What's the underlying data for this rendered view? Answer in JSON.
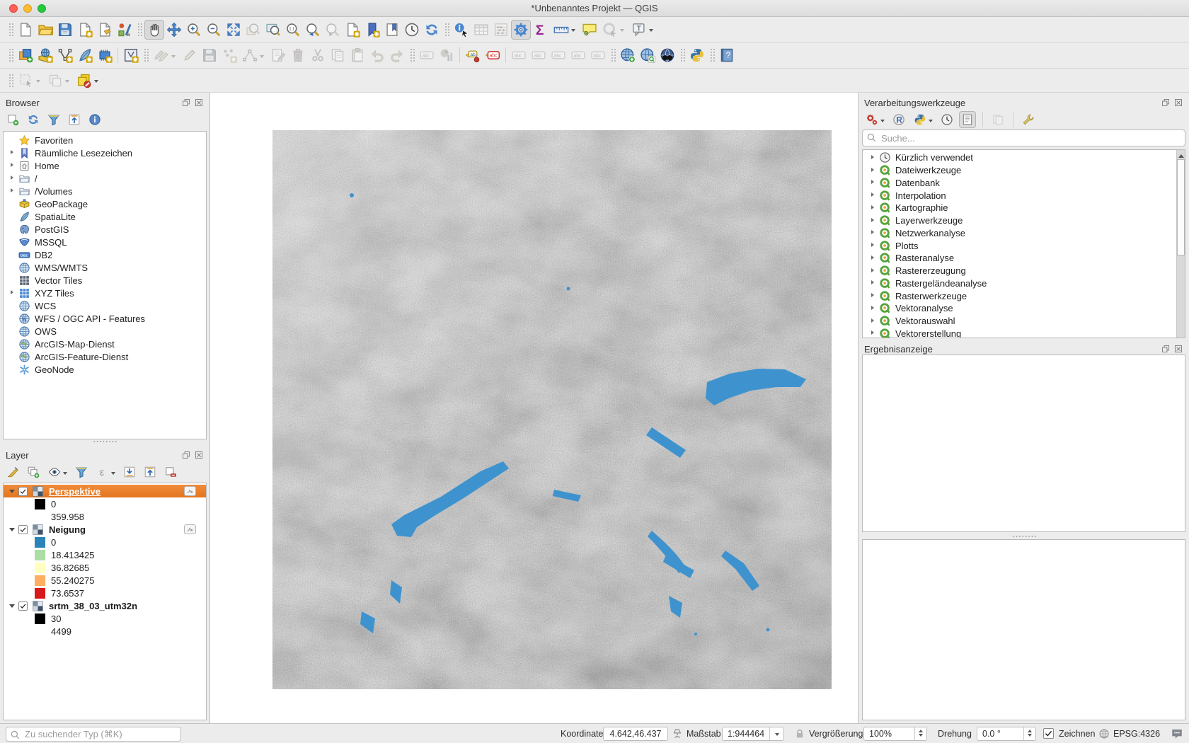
{
  "window": {
    "title": "*Unbenanntes Projekt — QGIS"
  },
  "colors": {
    "selection": "#e2761f",
    "selection_light": "#f08b3a",
    "lake": "#3e93cf"
  },
  "toolbars": {
    "row1": [
      {
        "t": "h"
      },
      {
        "t": "b",
        "name": "new-project",
        "icon": "file"
      },
      {
        "t": "b",
        "name": "open-project",
        "icon": "folder"
      },
      {
        "t": "b",
        "name": "save-project",
        "icon": "disk"
      },
      {
        "t": "b",
        "name": "new-print-layout",
        "icon": "layoutnew"
      },
      {
        "t": "b",
        "name": "layout-manager",
        "icon": "layoutmgr"
      },
      {
        "t": "b",
        "name": "style-manager",
        "icon": "style"
      },
      {
        "t": "h"
      },
      {
        "t": "b",
        "name": "pan-map",
        "icon": "hand",
        "st": "a"
      },
      {
        "t": "b",
        "name": "pan-to-selection",
        "icon": "move"
      },
      {
        "t": "b",
        "name": "zoom-in",
        "icon": "zin"
      },
      {
        "t": "b",
        "name": "zoom-out",
        "icon": "zout"
      },
      {
        "t": "b",
        "name": "zoom-full-extent",
        "icon": "zfull"
      },
      {
        "t": "b",
        "name": "zoom-to-selection",
        "icon": "zsel",
        "st": "d"
      },
      {
        "t": "b",
        "name": "zoom-to-layer",
        "icon": "zlayer"
      },
      {
        "t": "b",
        "name": "zoom-native-resolution",
        "icon": "znat"
      },
      {
        "t": "b",
        "name": "zoom-last",
        "icon": "zlast"
      },
      {
        "t": "b",
        "name": "zoom-next",
        "icon": "znext",
        "st": "d"
      },
      {
        "t": "b",
        "name": "new-map-view",
        "icon": "mapview"
      },
      {
        "t": "b",
        "name": "new-spatial-bookmark",
        "icon": "bmnew"
      },
      {
        "t": "b",
        "name": "show-spatial-bookmarks",
        "icon": "bm"
      },
      {
        "t": "b",
        "name": "temporal-controller",
        "icon": "clock"
      },
      {
        "t": "b",
        "name": "refresh-map",
        "icon": "refresh"
      },
      {
        "t": "h"
      },
      {
        "t": "b",
        "name": "identify-features",
        "icon": "identify"
      },
      {
        "t": "b",
        "name": "open-attribute-table",
        "icon": "table",
        "st": "d"
      },
      {
        "t": "b",
        "name": "show-statistics",
        "icon": "abacus",
        "st": "d"
      },
      {
        "t": "b",
        "name": "processing-toolbox-toggle",
        "icon": "gear",
        "st": "a"
      },
      {
        "t": "b",
        "name": "show-statistical-summary",
        "icon": "sigma"
      },
      {
        "t": "b",
        "name": "measure-line",
        "icon": "ruler",
        "dd": 1
      },
      {
        "t": "b",
        "name": "show-map-tips",
        "icon": "tip"
      },
      {
        "t": "b",
        "name": "run-feature-action",
        "icon": "action",
        "st": "d",
        "dd": 1
      },
      {
        "t": "b",
        "name": "text-annotation",
        "icon": "annot",
        "dd": 1
      }
    ],
    "row2": [
      {
        "t": "h"
      },
      {
        "t": "b",
        "name": "open-data-source-manager",
        "icon": "dsm"
      },
      {
        "t": "b",
        "name": "add-wms-layer",
        "icon": "addwms"
      },
      {
        "t": "b",
        "name": "add-vector-layer",
        "icon": "addvec"
      },
      {
        "t": "b",
        "name": "add-spatialite-layer",
        "icon": "addspat"
      },
      {
        "t": "b",
        "name": "add-postgis-layer",
        "icon": "addpg"
      },
      {
        "t": "s"
      },
      {
        "t": "b",
        "name": "new-virtual-layer",
        "icon": "virtual"
      },
      {
        "t": "h"
      },
      {
        "t": "b",
        "name": "current-edits",
        "icon": "pencils",
        "st": "d",
        "dd": 1
      },
      {
        "t": "b",
        "name": "toggle-editing",
        "icon": "pencil",
        "st": "d"
      },
      {
        "t": "b",
        "name": "save-layer-edits",
        "icon": "disk",
        "st": "d"
      },
      {
        "t": "b",
        "name": "digitize-points",
        "icon": "pts",
        "st": "d"
      },
      {
        "t": "b",
        "name": "vertex-tool",
        "icon": "vertex",
        "st": "d",
        "dd": 1
      },
      {
        "t": "b",
        "name": "modify-attributes",
        "icon": "form",
        "st": "d"
      },
      {
        "t": "b",
        "name": "delete-selected",
        "icon": "trash",
        "st": "d"
      },
      {
        "t": "b",
        "name": "cut-features",
        "icon": "cut",
        "st": "d"
      },
      {
        "t": "b",
        "name": "copy-features",
        "icon": "copy",
        "st": "d"
      },
      {
        "t": "b",
        "name": "paste-features",
        "icon": "paste",
        "st": "d"
      },
      {
        "t": "b",
        "name": "undo",
        "icon": "undo",
        "st": "d"
      },
      {
        "t": "b",
        "name": "redo",
        "icon": "redo",
        "st": "d"
      },
      {
        "t": "h"
      },
      {
        "t": "b",
        "name": "layer-labeling-options",
        "icon": "labelabc",
        "st": "d"
      },
      {
        "t": "b",
        "name": "layer-diagram-options",
        "icon": "diagram",
        "st": "d"
      },
      {
        "t": "s"
      },
      {
        "t": "b",
        "name": "labeling-pin-settings",
        "icon": "abpin"
      },
      {
        "t": "b",
        "name": "label-highlight",
        "icon": "abcred"
      },
      {
        "t": "s"
      },
      {
        "t": "b",
        "name": "pin-unpin-labels",
        "icon": "labelabc",
        "st": "d"
      },
      {
        "t": "b",
        "name": "show-hidden-labels",
        "icon": "labelabc",
        "st": "d"
      },
      {
        "t": "b",
        "name": "move-label",
        "icon": "labelabc",
        "st": "d"
      },
      {
        "t": "b",
        "name": "rotate-label",
        "icon": "labelabc",
        "st": "d"
      },
      {
        "t": "b",
        "name": "change-label",
        "icon": "labelabc",
        "st": "d"
      },
      {
        "t": "h"
      },
      {
        "t": "b",
        "name": "metasearch-new-service",
        "icon": "gplus"
      },
      {
        "t": "b",
        "name": "metasearch",
        "icon": "gq"
      },
      {
        "t": "b",
        "name": "osm-place-search",
        "icon": "gbin"
      },
      {
        "t": "h"
      },
      {
        "t": "b",
        "name": "python-console",
        "icon": "python"
      },
      {
        "t": "h"
      },
      {
        "t": "b",
        "name": "help-contents",
        "icon": "help"
      }
    ],
    "row3": [
      {
        "t": "h"
      },
      {
        "t": "b",
        "name": "select-features",
        "icon": "selcur",
        "st": "d",
        "dd": 1
      },
      {
        "t": "b",
        "name": "deselect-features",
        "icon": "desel",
        "st": "d",
        "dd": 1
      },
      {
        "t": "b",
        "name": "overlap-control",
        "icon": "overlap",
        "dd": 1
      }
    ]
  },
  "browser": {
    "title": "Browser",
    "tools": [
      {
        "t": "b",
        "name": "browser-add-selected-layers",
        "icon": "addlayer"
      },
      {
        "t": "b",
        "name": "browser-refresh",
        "icon": "refresh"
      },
      {
        "t": "b",
        "name": "browser-filter",
        "icon": "funnel"
      },
      {
        "t": "b",
        "name": "browser-collapse-all",
        "icon": "collapseall"
      },
      {
        "t": "b",
        "name": "browser-properties",
        "icon": "info"
      }
    ],
    "items": [
      {
        "label": "Favoriten",
        "icon": "star",
        "arrow": false,
        "name": "browser-item-favoriten"
      },
      {
        "label": "Räumliche Lesezeichen",
        "icon": "bookmark",
        "name": "browser-item-lesezeichen"
      },
      {
        "label": "Home",
        "icon": "home",
        "name": "browser-item-home"
      },
      {
        "label": "/",
        "icon": "folder2",
        "name": "browser-item-root"
      },
      {
        "label": "/Volumes",
        "icon": "folder2",
        "name": "browser-item-volumes"
      },
      {
        "label": "GeoPackage",
        "icon": "geopackage",
        "arrow": false,
        "name": "browser-item-geopackage"
      },
      {
        "label": "SpatiaLite",
        "icon": "feather",
        "arrow": false,
        "name": "browser-item-spatialite"
      },
      {
        "label": "PostGIS",
        "icon": "postgis",
        "arrow": false,
        "name": "browser-item-postgis"
      },
      {
        "label": "MSSQL",
        "icon": "mssql",
        "arrow": false,
        "name": "browser-item-mssql"
      },
      {
        "label": "DB2",
        "icon": "db2",
        "arrow": false,
        "name": "browser-item-db2"
      },
      {
        "label": "WMS/WMTS",
        "icon": "globe",
        "arrow": false,
        "name": "browser-item-wms"
      },
      {
        "label": "Vector Tiles",
        "icon": "gridd",
        "arrow": false,
        "name": "browser-item-vector-tiles"
      },
      {
        "label": "XYZ Tiles",
        "icon": "gridb",
        "name": "browser-item-xyz-tiles"
      },
      {
        "label": "WCS",
        "icon": "globe",
        "arrow": false,
        "name": "browser-item-wcs"
      },
      {
        "label": "WFS / OGC API - Features",
        "icon": "globew",
        "arrow": false,
        "name": "browser-item-wfs"
      },
      {
        "label": "OWS",
        "icon": "globe",
        "arrow": false,
        "name": "browser-item-ows"
      },
      {
        "label": "ArcGIS-Map-Dienst",
        "icon": "globearc",
        "arrow": false,
        "name": "browser-item-arcgis-map"
      },
      {
        "label": "ArcGIS-Feature-Dienst",
        "icon": "globearc",
        "arrow": false,
        "name": "browser-item-arcgis-feature"
      },
      {
        "label": "GeoNode",
        "icon": "geonode",
        "arrow": false,
        "name": "browser-item-geonode"
      }
    ]
  },
  "layers": {
    "title": "Layer",
    "tools": [
      {
        "t": "b",
        "name": "open-layer-styling",
        "icon": "brush"
      },
      {
        "t": "b",
        "name": "add-group",
        "icon": "addgroup"
      },
      {
        "t": "b",
        "name": "manage-map-themes",
        "icon": "eye",
        "dd": 1
      },
      {
        "t": "b",
        "name": "filter-legend",
        "icon": "funnel"
      },
      {
        "t": "b",
        "name": "filter-by-expression",
        "icon": "eps",
        "dd": 1
      },
      {
        "t": "b",
        "name": "expand-all-layers",
        "icon": "expandall"
      },
      {
        "t": "b",
        "name": "collapse-all-layers",
        "icon": "collapseall"
      },
      {
        "t": "b",
        "name": "remove-layer",
        "icon": "removelayer"
      }
    ],
    "tree": [
      {
        "tpl": "tpl-layerrow",
        "name": "layer-perspektive",
        "label": "Perspektive",
        "icon": "raster",
        "sel": true,
        "badge": true
      },
      {
        "color": "#000000",
        "label": "0"
      },
      {
        "color": "#ffffff",
        "label": "359.958"
      },
      {
        "tpl": "tpl-layerrow",
        "name": "layer-neigung",
        "label": "Neigung",
        "icon": "raster",
        "badge": true
      },
      {
        "color": "#2b83ba",
        "label": "0"
      },
      {
        "color": "#abdda4",
        "label": "18.413425"
      },
      {
        "color": "#ffffbf",
        "label": "36.82685"
      },
      {
        "color": "#fdae61",
        "label": "55.240275"
      },
      {
        "color": "#d7191c",
        "label": "73.6537"
      },
      {
        "tpl": "tpl-layerrow",
        "name": "layer-srtm",
        "label": "srtm_38_03_utm32n",
        "icon": "raster"
      },
      {
        "color": "#000000",
        "label": "30"
      },
      {
        "color": "#ffffff",
        "label": "4499"
      }
    ]
  },
  "toolbox": {
    "title": "Verarbeitungswerkzeuge",
    "search_placeholder": "Suche...",
    "tools": [
      {
        "t": "b",
        "name": "processing-models",
        "icon": "models",
        "dd": 1
      },
      {
        "t": "b",
        "name": "r-scripts",
        "icon": "ricon"
      },
      {
        "t": "b",
        "name": "python-scripts",
        "icon": "python",
        "dd": 1
      },
      {
        "t": "b",
        "name": "processing-history",
        "icon": "clock"
      },
      {
        "t": "b",
        "name": "processing-log",
        "icon": "log",
        "st": "a"
      },
      {
        "t": "s"
      },
      {
        "t": "b",
        "name": "results-viewer",
        "icon": "results",
        "st": "d"
      },
      {
        "t": "s"
      },
      {
        "t": "b",
        "name": "processing-options",
        "icon": "wrench"
      }
    ],
    "items": [
      {
        "label": "Kürzlich verwendet",
        "icon": "clock",
        "name": "toolbox-recently-used"
      },
      {
        "label": "Dateiwerkzeuge",
        "icon": "q",
        "name": "toolbox-dateiwerkzeuge"
      },
      {
        "label": "Datenbank",
        "icon": "q",
        "name": "toolbox-datenbank"
      },
      {
        "label": "Interpolation",
        "icon": "q",
        "name": "toolbox-interpolation"
      },
      {
        "label": "Kartographie",
        "icon": "q",
        "name": "toolbox-kartographie"
      },
      {
        "label": "Layerwerkzeuge",
        "icon": "q",
        "name": "toolbox-layerwerkzeuge"
      },
      {
        "label": "Netzwerkanalyse",
        "icon": "q",
        "name": "toolbox-netzwerkanalyse"
      },
      {
        "label": "Plotts",
        "icon": "q",
        "name": "toolbox-plotts"
      },
      {
        "label": "Rasteranalyse",
        "icon": "q",
        "name": "toolbox-rasteranalyse"
      },
      {
        "label": "Rastererzeugung",
        "icon": "q",
        "name": "toolbox-rastererzeugung"
      },
      {
        "label": "Rastergeländeanalyse",
        "icon": "q",
        "name": "toolbox-rastergelaendeanalyse"
      },
      {
        "label": "Rasterwerkzeuge",
        "icon": "q",
        "name": "toolbox-rasterwerkzeuge"
      },
      {
        "label": "Vektoranalyse",
        "icon": "q",
        "name": "toolbox-vektoranalyse"
      },
      {
        "label": "Vektorauswahl",
        "icon": "q",
        "name": "toolbox-vektorauswahl"
      },
      {
        "label": "Vektorerstellung",
        "icon": "q",
        "name": "toolbox-vektorerstellung"
      }
    ]
  },
  "results": {
    "title": "Ergebnisanzeige"
  },
  "statusbar": {
    "search_placeholder": "Zu suchender Typ (⌘K)",
    "coord_label": "Koordinate",
    "coord_value": "4.642,46.437",
    "scale_label": "Maßstab",
    "scale_value": "1:944464",
    "magnifier_label": "Vergrößerung",
    "magnifier_value": "100%",
    "rotation_label": "Drehung",
    "rotation_value": "0.0 °",
    "render_label": "Zeichnen",
    "crs": "EPSG:4326"
  }
}
